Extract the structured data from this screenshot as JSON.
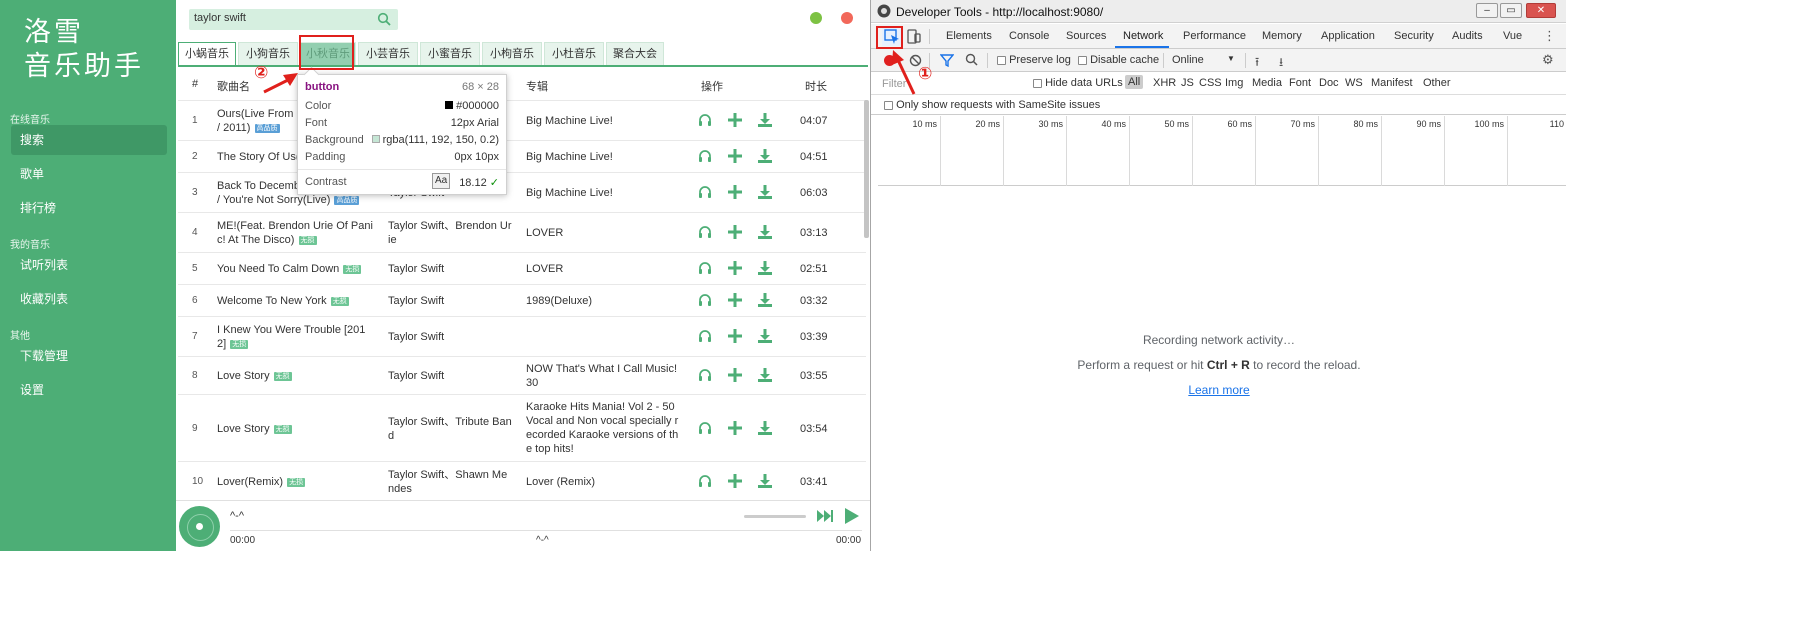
{
  "app": {
    "logo_line1": "洛雪",
    "logo_line2": "音乐助手",
    "sidebar": {
      "sections": [
        "在线音乐",
        "我的音乐",
        "其他"
      ],
      "items": [
        "搜索",
        "歌单",
        "排行榜",
        "试听列表",
        "收藏列表",
        "下载管理",
        "设置"
      ],
      "active": "搜索"
    },
    "search": {
      "value": "taylor swift"
    },
    "window_dots": {
      "green": "#7dc243",
      "red": "#f2685a"
    },
    "tabs": [
      "小蜗音乐",
      "小狗音乐",
      "小秋音乐",
      "小芸音乐",
      "小蜜音乐",
      "小枸音乐",
      "小杜音乐",
      "聚合大会"
    ],
    "active_tab": "小蜗音乐",
    "highlighted_tab": "小秋音乐",
    "columns": {
      "num": "#",
      "song": "歌曲名",
      "album": "专辑",
      "actions": "操作",
      "duration": "时长"
    },
    "rows": [
      {
        "num": "1",
        "song": "Ours(Live From B",
        "song2": "/ 2011)",
        "tag": "高品质",
        "artist": "",
        "album": "Big Machine Live!",
        "duration": "04:07"
      },
      {
        "num": "2",
        "song": "The Story Of Us(",
        "song2": "",
        "tag": "",
        "artist": "",
        "album": "Big Machine Live!",
        "duration": "04:51"
      },
      {
        "num": "3",
        "song": "Back To Decemb",
        "song2": "/ You're Not Sorry(Live)",
        "tag": "高品质",
        "artist": "Taylor Swift",
        "album": "Big Machine Live!",
        "duration": "06:03"
      },
      {
        "num": "4",
        "song": "ME!(Feat. Brendon Urie Of Pani",
        "song2": "c! At The Disco)",
        "tag": "无损",
        "artist": "Taylor Swift、Brendon Ur",
        "artist2": "ie",
        "album": "LOVER",
        "duration": "03:13"
      },
      {
        "num": "5",
        "song": "You Need To Calm Down",
        "song2": "",
        "tag": "无损",
        "artist": "Taylor Swift",
        "album": "LOVER",
        "duration": "02:51"
      },
      {
        "num": "6",
        "song": "Welcome To New York",
        "song2": "",
        "tag": "无损",
        "artist": "Taylor Swift",
        "album": "1989(Deluxe)",
        "duration": "03:32"
      },
      {
        "num": "7",
        "song": "I Knew You Were Trouble [201",
        "song2": "2]",
        "tag": "无损",
        "artist": "Taylor Swift",
        "album": "",
        "duration": "03:39"
      },
      {
        "num": "8",
        "song": "Love Story",
        "song2": "",
        "tag": "无损",
        "artist": "Taylor Swift",
        "album": "NOW That's What I Call Music!",
        "album2": "30",
        "duration": "03:55"
      },
      {
        "num": "9",
        "song": "Love Story",
        "song2": "",
        "tag": "无损",
        "artist": "Taylor Swift、Tribute Ban",
        "artist2": "d",
        "album": "Karaoke Hits Mania! Vol 2 - 50",
        "album2": "Vocal and Non vocal specially r",
        "album3": "ecorded Karaoke versions of th",
        "album4": "e top hits!",
        "duration": "03:54"
      },
      {
        "num": "10",
        "song": "Lover(Remix)",
        "song2": "",
        "tag": "无损",
        "artist": "Taylor Swift、Shawn Me",
        "artist2": "ndes",
        "album": "Lover (Remix)",
        "duration": "03:41"
      }
    ],
    "player": {
      "title": "^-^",
      "time_current": "00:00",
      "time_total": "00:00",
      "mid": "^-^"
    },
    "accent": "#4dae76"
  },
  "tooltip": {
    "element": "button",
    "size": "68 × 28",
    "rows": [
      {
        "label": "Color",
        "value": "#000000"
      },
      {
        "label": "Font",
        "value": "12px Arial"
      },
      {
        "label": "Background",
        "value": "rgba(111, 192, 150, 0.2)"
      },
      {
        "label": "Padding",
        "value": "0px 10px"
      },
      {
        "label": "Contrast",
        "value": "18.12"
      }
    ],
    "aa": "Aa"
  },
  "annotations": {
    "one": "①",
    "two": "②"
  },
  "devtools": {
    "title": "Developer Tools - http://localhost:9080/",
    "tabs": [
      "Elements",
      "Console",
      "Sources",
      "Network",
      "Performance",
      "Memory",
      "Application",
      "Security",
      "Audits",
      "Vue"
    ],
    "active_tab": "Network",
    "toolbar": {
      "preserve_log": "Preserve log",
      "disable_cache": "Disable cache",
      "throttle": "Online"
    },
    "filter": {
      "placeholder": "Filter",
      "hide_data_urls": "Hide data URLs",
      "types": [
        "All",
        "XHR",
        "JS",
        "CSS",
        "Img",
        "Media",
        "Font",
        "Doc",
        "WS",
        "Manifest",
        "Other"
      ]
    },
    "samesite": "Only show requests with SameSite issues",
    "ticks": [
      "10 ms",
      "20 ms",
      "30 ms",
      "40 ms",
      "50 ms",
      "60 ms",
      "70 ms",
      "80 ms",
      "90 ms",
      "100 ms",
      "110"
    ],
    "empty": {
      "line1": "Recording network activity…",
      "line2_pre": "Perform a request or hit ",
      "line2_key": "Ctrl + R",
      "line2_post": " to record the reload.",
      "link": "Learn more"
    }
  }
}
